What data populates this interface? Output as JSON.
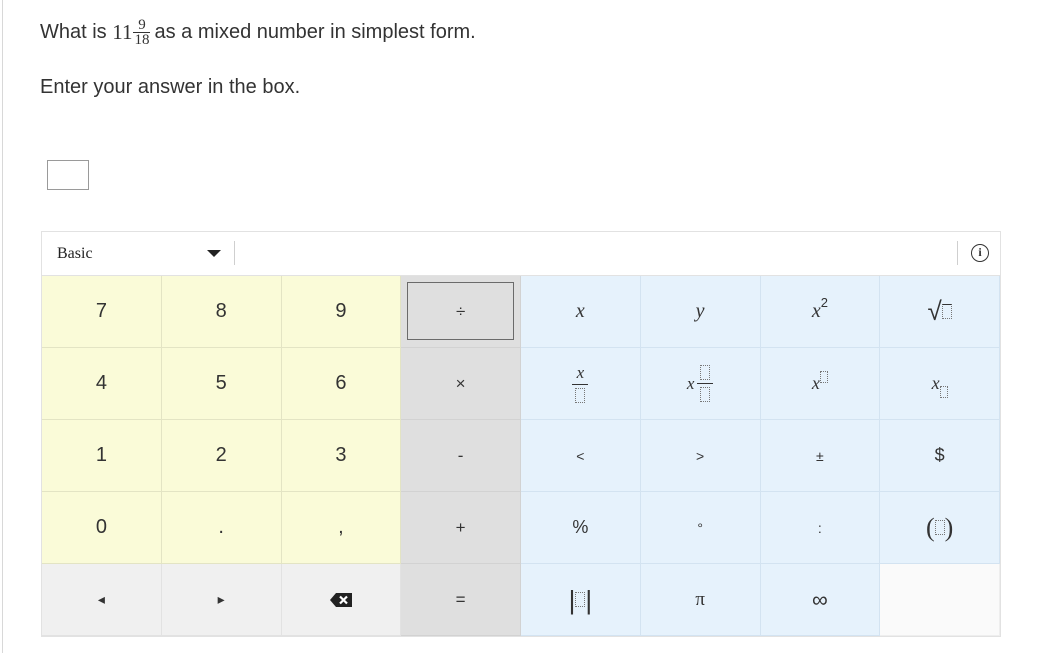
{
  "question": {
    "prefix": "What is",
    "mixed_whole": "11",
    "mixed_numerator": "9",
    "mixed_denominator": "18",
    "suffix": "as a mixed number in simplest form."
  },
  "instruction": "Enter your answer in the box.",
  "answer_box": {
    "value": ""
  },
  "keypad": {
    "mode": "Basic",
    "info_icon_label": "i",
    "keys": {
      "row1": [
        "7",
        "8",
        "9",
        "÷",
        "x",
        "y",
        "x",
        "2",
        "√"
      ],
      "row2": [
        "4",
        "5",
        "6",
        "×",
        "x",
        "x",
        "x",
        "x"
      ],
      "row3": [
        "1",
        "2",
        "3",
        "-",
        "<",
        ">",
        "±",
        "$"
      ],
      "row4": [
        "0",
        ".",
        ",",
        "+",
        "%",
        "°",
        ":",
        "(",
        ")"
      ],
      "row5": [
        "◂",
        "▸",
        "=",
        "|",
        "|",
        "π",
        "∞"
      ]
    },
    "colors": {
      "number_keys": "#fafbd8",
      "operator_keys": "#dfdfdf",
      "variable_keys": "#e6f2fc",
      "nav_keys": "#f0f0f0"
    }
  }
}
